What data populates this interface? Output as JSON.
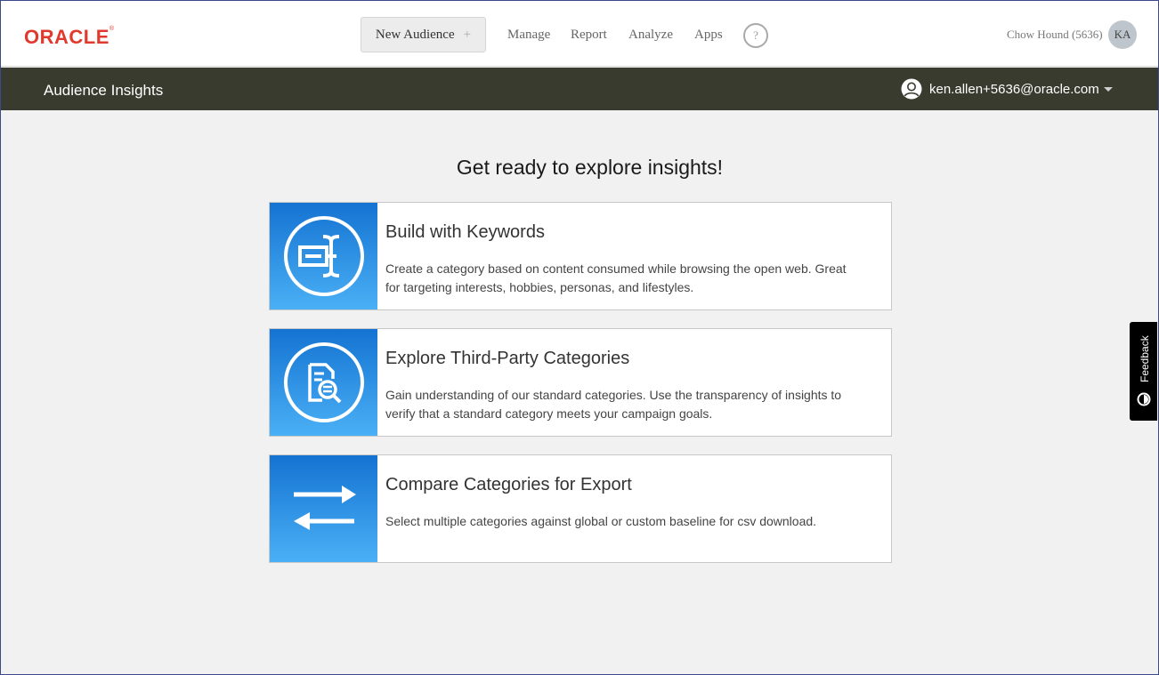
{
  "brand": {
    "logo_text": "ORACLE",
    "trademark": "®"
  },
  "topnav": {
    "new_audience_label": "New Audience",
    "new_audience_plus": "+",
    "links": [
      "Manage",
      "Report",
      "Analyze",
      "Apps"
    ],
    "help_label": "?",
    "account_label": "Chow Hound (5636)",
    "avatar_initials": "KA"
  },
  "subbar": {
    "title": "Audience Insights",
    "user_email": "ken.allen+5636@oracle.com"
  },
  "main": {
    "headline": "Get ready to explore insights!",
    "cards": [
      {
        "title": "Build with Keywords",
        "description": "Create a category based on content consumed while browsing the open web. Great for targeting interests, hobbies, personas, and lifestyles.",
        "icon": "keyword-cursor-icon"
      },
      {
        "title": "Explore Third-Party Categories",
        "description": "Gain understanding of our standard categories. Use the transparency of insights to verify that a standard category meets your campaign goals.",
        "icon": "document-search-icon"
      },
      {
        "title": "Compare Categories for Export",
        "description": "Select multiple categories against global or custom baseline for csv download.",
        "icon": "swap-arrows-icon"
      }
    ]
  },
  "feedback": {
    "label": "Feedback"
  },
  "colors": {
    "brand_red": "#e03a2f",
    "subbar_bg": "#393b2f",
    "icon_gradient_top": "#1473d2",
    "icon_gradient_bottom": "#4ab0f5"
  }
}
